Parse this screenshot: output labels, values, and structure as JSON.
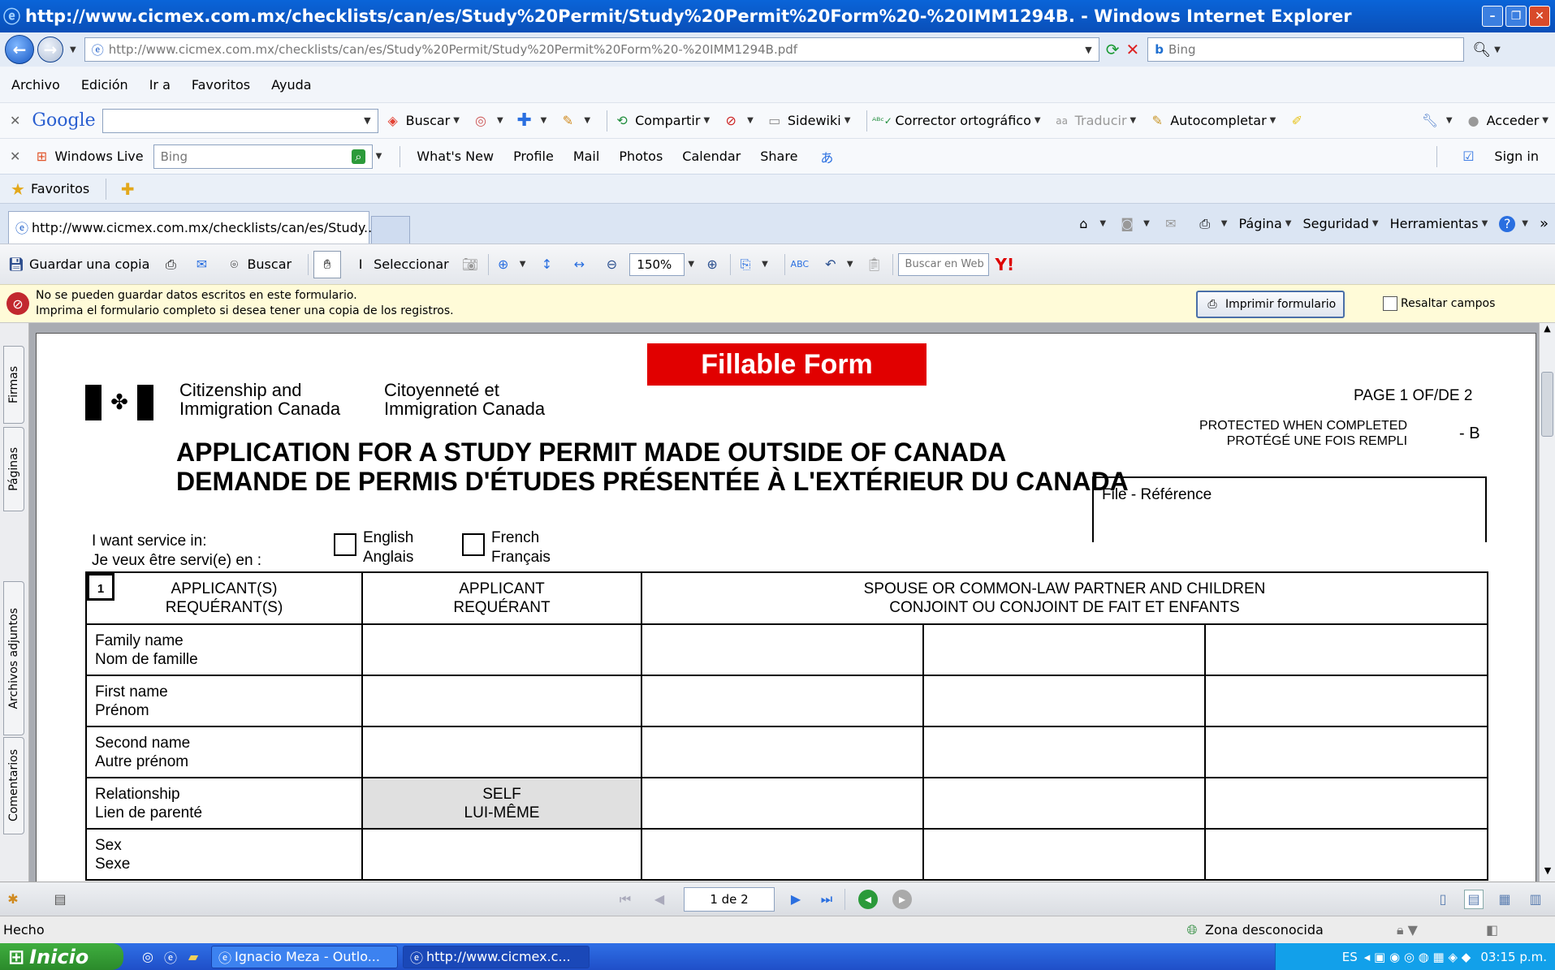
{
  "window": {
    "title": "http://www.cicmex.com.mx/checklists/can/es/Study%20Permit/Study%20Permit%20Form%20-%20IMM1294B. - Windows Internet Explorer"
  },
  "address": {
    "url": "http://www.cicmex.com.mx/checklists/can/es/Study%20Permit/Study%20Permit%20Form%20-%20IMM1294B.pdf",
    "search_placeholder": "Bing"
  },
  "menu": [
    "Archivo",
    "Edición",
    "Ir a",
    "Favoritos",
    "Ayuda"
  ],
  "google_toolbar": {
    "brand": "Google",
    "search": "Buscar",
    "share": "Compartir",
    "sidewiki": "Sidewiki",
    "spell": "Corrector ortográfico",
    "translate": "Traducir",
    "autofill": "Autocompletar",
    "signin": "Acceder"
  },
  "windows_live": {
    "brand": "Windows Live",
    "search_placeholder": "Bing",
    "links": [
      "What's New",
      "Profile",
      "Mail",
      "Photos",
      "Calendar",
      "Share"
    ],
    "signin": "Sign in"
  },
  "favorites": {
    "label": "Favoritos"
  },
  "tab": {
    "title": "http://www.cicmex.com.mx/checklists/can/es/Study...",
    "page": "Página",
    "security": "Seguridad",
    "tools": "Herramientas"
  },
  "pdf_toolbar": {
    "save": "Guardar una copia",
    "find": "Buscar",
    "select": "Seleccionar",
    "zoom": "150%",
    "web_search_placeholder": "Buscar en Web"
  },
  "notice": {
    "line1": "No se pueden guardar datos escritos en este formulario.",
    "line2": "Imprima el formulario completo si desea tener una copia de los registros.",
    "print": "Imprimir formulario",
    "highlight": "Resaltar campos"
  },
  "side_tabs": [
    "Firmas",
    "Páginas",
    "Archivos adjuntos",
    "Comentarios"
  ],
  "form": {
    "banner": "Fillable Form",
    "dept_en_1": "Citizenship and",
    "dept_en_2": "Immigration Canada",
    "dept_fr_1": "Citoyenneté et",
    "dept_fr_2": "Immigration Canada",
    "page": "PAGE 1 OF/DE 2",
    "protected_1": "PROTECTED WHEN COMPLETED",
    "protected_2": "PROTÉGÉ UNE FOIS REMPLI",
    "protected_b": "- B",
    "title_en": "APPLICATION FOR A STUDY PERMIT MADE OUTSIDE OF CANADA",
    "title_fr": "DEMANDE DE PERMIS D'ÉTUDES PRÉSENTÉE À L'EXTÉRIEUR DU CANADA",
    "service_1": "I want service in:",
    "service_2": "Je veux être servi(e) en :",
    "english_1": "English",
    "english_2": "Anglais",
    "french_1": "French",
    "french_2": "Français",
    "file_ref": "File - Référence",
    "section_no": "1",
    "col1_1": "APPLICANT(S)",
    "col1_2": "REQUÉRANT(S)",
    "col2_1": "APPLICANT",
    "col2_2": "REQUÉRANT",
    "col3_1": "SPOUSE OR COMMON-LAW PARTNER AND CHILDREN",
    "col3_2": "CONJOINT OU CONJOINT DE FAIT ET ENFANTS",
    "rows": [
      {
        "en": "Family name",
        "fr": "Nom de famille"
      },
      {
        "en": "First name",
        "fr": "Prénom"
      },
      {
        "en": "Second name",
        "fr": "Autre prénom"
      },
      {
        "en": "Relationship",
        "fr": "Lien de parenté"
      },
      {
        "en": "Sex",
        "fr": "Sexe"
      }
    ],
    "self_1": "SELF",
    "self_2": "LUI-MÊME"
  },
  "pdf_nav": {
    "page": "1 de 2"
  },
  "status": {
    "text": "Hecho",
    "zone": "Zona desconocida"
  },
  "taskbar": {
    "start": "Inicio",
    "tasks": [
      "Ignacio Meza - Outlo...",
      "http://www.cicmex.c..."
    ],
    "lang": "ES",
    "time": "03:15 p.m."
  }
}
